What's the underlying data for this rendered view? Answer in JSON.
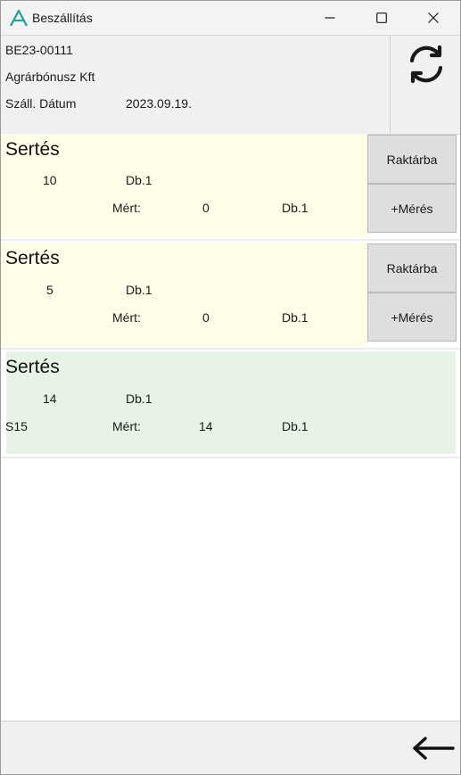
{
  "window": {
    "title": "Beszállítás",
    "controls": [
      "minimize-icon",
      "maximize-icon",
      "close-icon"
    ]
  },
  "header": {
    "delivery_id": "BE23-00111",
    "partner": "Agrárbónusz Kft",
    "date_label": "Száll. Dátum",
    "date_value": "2023.09.19.",
    "refresh_icon": "refresh-icon"
  },
  "items": [
    {
      "name": "Sertés",
      "qty": "10",
      "unit": "Db.1",
      "code": "",
      "measured_label": "Mért:",
      "measured_value": "0",
      "measured_unit": "Db.1",
      "stock_button": "Raktárba",
      "measure_button": "+Mérés",
      "status_color": "#fdfde8"
    },
    {
      "name": "Sertés",
      "qty": "5",
      "unit": "Db.1",
      "code": "",
      "measured_label": "Mért:",
      "measured_value": "0",
      "measured_unit": "Db.1",
      "stock_button": "Raktárba",
      "measure_button": "+Mérés",
      "status_color": "#fdfde8"
    },
    {
      "name": "Sertés",
      "qty": "14",
      "unit": "Db.1",
      "code": "S15",
      "measured_label": "Mért:",
      "measured_value": "14",
      "measured_unit": "Db.1",
      "status_color": "#e7f3e6"
    }
  ],
  "footer": {
    "back_icon": "arrow-left-icon"
  }
}
